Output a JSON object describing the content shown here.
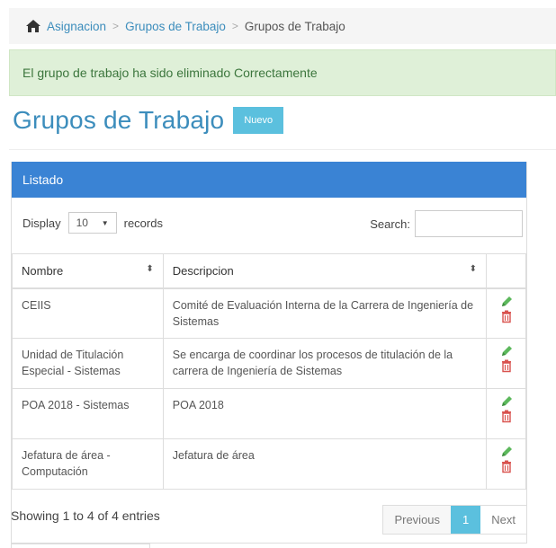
{
  "breadcrumb": {
    "icon": "home-icon",
    "items": [
      "Asignacion",
      "Grupos de Trabajo"
    ],
    "current": "Grupos de Trabajo"
  },
  "alert": {
    "message": "El grupo de trabajo ha sido eliminado Correctamente",
    "color": "#3c763d"
  },
  "page": {
    "title": "Grupos de Trabajo",
    "new_button": "Nuevo"
  },
  "panel": {
    "title": "Listado",
    "header_color": "#3a83d4"
  },
  "controls": {
    "display_label": "Display",
    "display_value": "10",
    "records_label": "records",
    "search_label": "Search:",
    "search_value": ""
  },
  "table": {
    "columns": [
      "Nombre",
      "Descripcion",
      ""
    ],
    "rows": [
      {
        "nombre": "CEIIS",
        "descripcion": "Comité de Evaluación Interna de la Carrera de Ingeniería de Sistemas"
      },
      {
        "nombre": "Unidad de Titulación Especial - Sistemas",
        "descripcion": "Se encarga de coordinar los procesos de titulación de la carrera de Ingeniería de Sistemas"
      },
      {
        "nombre": "POA 2018 - Sistemas",
        "descripcion": "POA 2018"
      },
      {
        "nombre": "Jefatura de área - Computación",
        "descripcion": "Jefatura de área"
      }
    ],
    "action_icons": [
      "pencil-icon",
      "trash-icon"
    ],
    "edit_color": "#5cb85c",
    "delete_color": "#d9534f"
  },
  "footer": {
    "info": "Showing 1 to 4 of 4 entries"
  },
  "pagination": {
    "previous": "Previous",
    "current": "1",
    "next": "Next"
  }
}
